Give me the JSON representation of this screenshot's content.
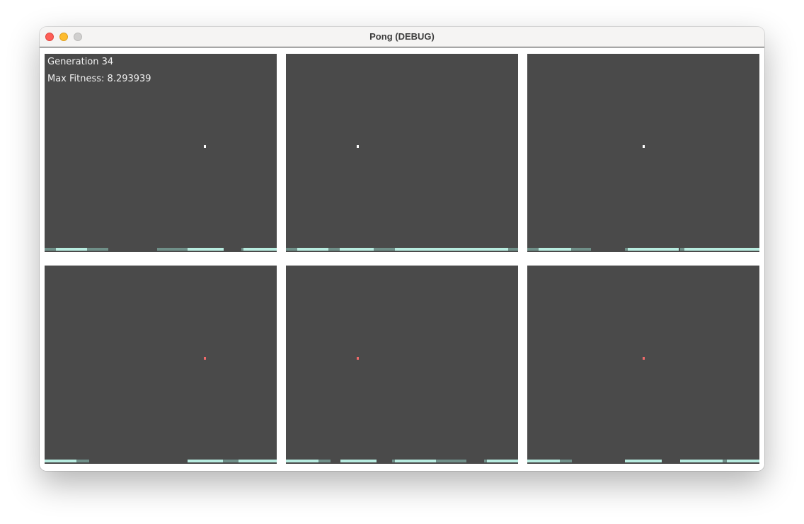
{
  "window": {
    "title": "Pong (DEBUG)"
  },
  "hud": {
    "generation": "Generation 34",
    "max_fitness": "Max Fitness: 8.293939"
  },
  "colors": {
    "panel_background": "#4a4a4a",
    "paddle": "#b8ece0",
    "paddle_faded": "#6f8f88",
    "ball_active": "#ffffff",
    "ball_missed": "#f06a6a",
    "close_button": "#fe5f57",
    "minimize_button": "#febc2e",
    "zoom_button": "#d0cfce"
  },
  "icons": {
    "close": "close-icon",
    "minimize": "minimize-icon",
    "zoom": "zoom-icon"
  }
}
